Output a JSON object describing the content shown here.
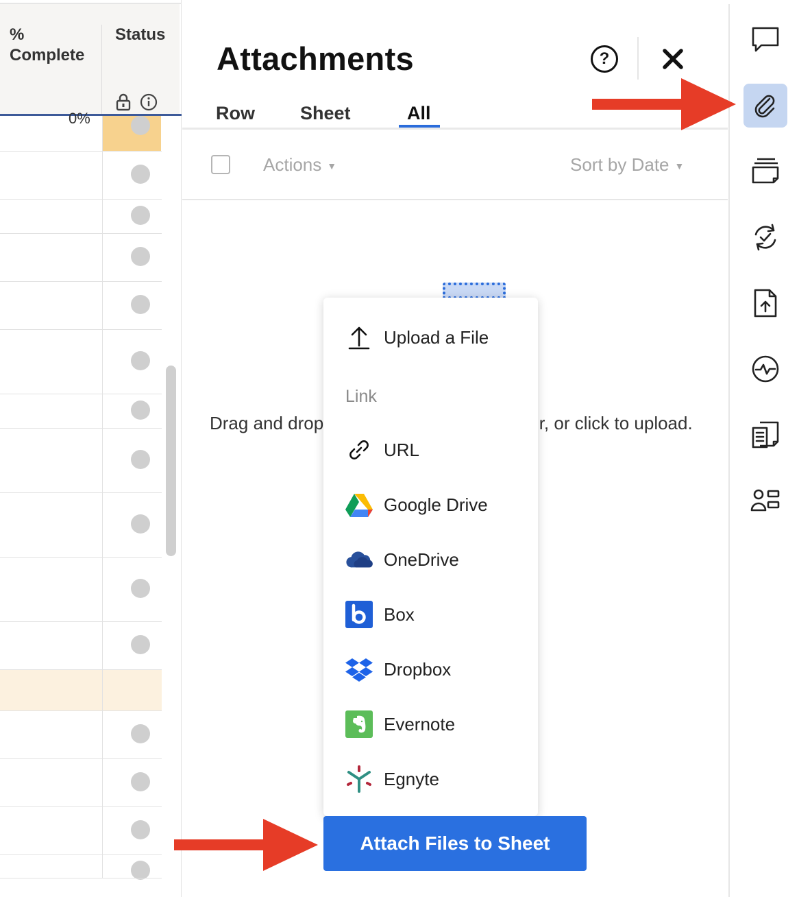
{
  "grid": {
    "col_complete_header": "% Complete",
    "col_status_header": "Status",
    "partial_cell_text": "0%",
    "status_colors": {
      "dot_gray": "#cfcfcf",
      "highlight_orange": "#f7d28e",
      "highlight_cream": "#fcf1df"
    }
  },
  "panel": {
    "title": "Attachments",
    "help_label": "?",
    "tabs": [
      "Row",
      "Sheet",
      "All"
    ],
    "active_tab": "All",
    "actions_label": "Actions",
    "sort_label": "Sort by Date",
    "drop_hint": "Drag and drop files here, or click to upload.",
    "drop_hint_left": "Drag and drop",
    "drop_hint_right": "r, or click to upload."
  },
  "menu": {
    "upload_label": "Upload a File",
    "link_section": "Link",
    "items": [
      {
        "label": "URL",
        "icon": "link-icon"
      },
      {
        "label": "Google Drive",
        "icon": "google-drive-icon"
      },
      {
        "label": "OneDrive",
        "icon": "onedrive-icon"
      },
      {
        "label": "Box",
        "icon": "box-icon"
      },
      {
        "label": "Dropbox",
        "icon": "dropbox-icon"
      },
      {
        "label": "Evernote",
        "icon": "evernote-icon"
      },
      {
        "label": "Egnyte",
        "icon": "egnyte-icon"
      }
    ]
  },
  "attach_button": {
    "label": "Attach Files to Sheet",
    "color": "#2a70e0"
  },
  "rail": {
    "items": [
      {
        "name": "comments",
        "icon": "comment-icon"
      },
      {
        "name": "attachments",
        "icon": "paperclip-icon",
        "active": true
      },
      {
        "name": "proofs",
        "icon": "proofs-icon"
      },
      {
        "name": "update-requests",
        "icon": "update-request-icon"
      },
      {
        "name": "publish",
        "icon": "file-upload-icon"
      },
      {
        "name": "activity-log",
        "icon": "activity-icon"
      },
      {
        "name": "summary",
        "icon": "summary-icon"
      },
      {
        "name": "people",
        "icon": "people-icon"
      }
    ]
  },
  "colors": {
    "accent": "#2a70e0",
    "annotation_arrow": "#e63c27",
    "rail_active_bg": "#c5d6f1"
  }
}
